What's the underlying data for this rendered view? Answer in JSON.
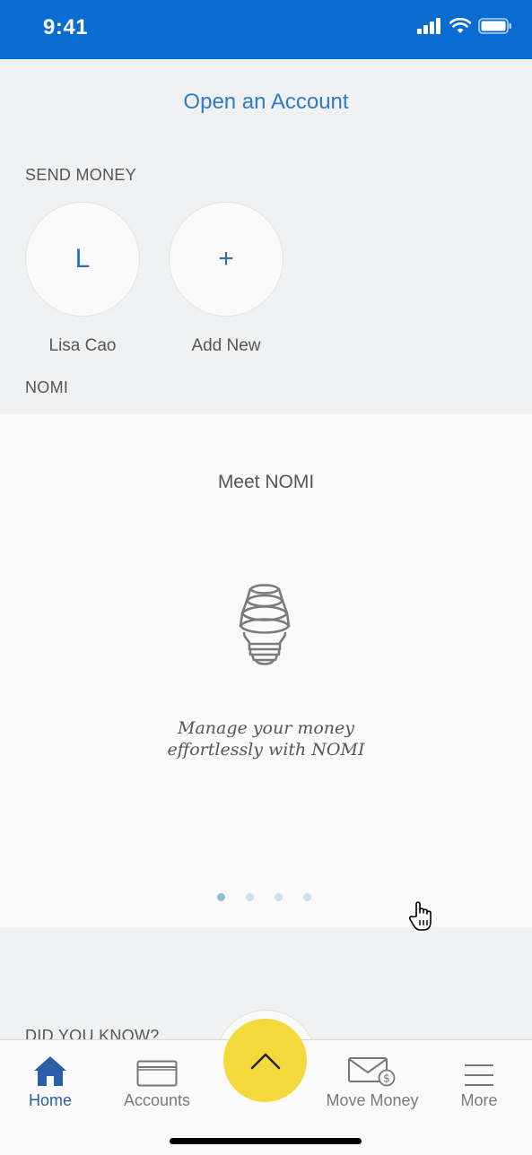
{
  "status_bar": {
    "time": "9:41"
  },
  "header": {
    "open_account_label": "Open an Account"
  },
  "send_money": {
    "section_label": "SEND MONEY",
    "contacts": [
      {
        "initial": "L",
        "name": "Lisa Cao"
      },
      {
        "initial": "+",
        "name": "Add New"
      }
    ]
  },
  "nomi": {
    "section_label": "NOMI",
    "card_title": "Meet NOMI",
    "copy_line1": "Manage your money",
    "copy_line2": "effortlessly with NOMI",
    "icon": "lightbulb-icon",
    "carousel_pages": 4,
    "carousel_active_index": 0
  },
  "did_you_know": {
    "label": "DID YOU KNOW?"
  },
  "tab_bar": {
    "tabs": [
      {
        "label": "Home",
        "icon": "home-icon",
        "active": true
      },
      {
        "label": "Accounts",
        "icon": "card-icon",
        "active": false
      },
      {
        "label": "Move Money",
        "icon": "envelope-dollar-icon",
        "active": false
      },
      {
        "label": "More",
        "icon": "menu-icon",
        "active": false
      }
    ],
    "center_button_icon": "chevron-up-icon"
  },
  "colors": {
    "status_bar": "#0a6bd0",
    "accent_blue": "#2f7ac9",
    "fab_yellow": "#f4d93c",
    "active_tab": "#2a5fa8"
  }
}
